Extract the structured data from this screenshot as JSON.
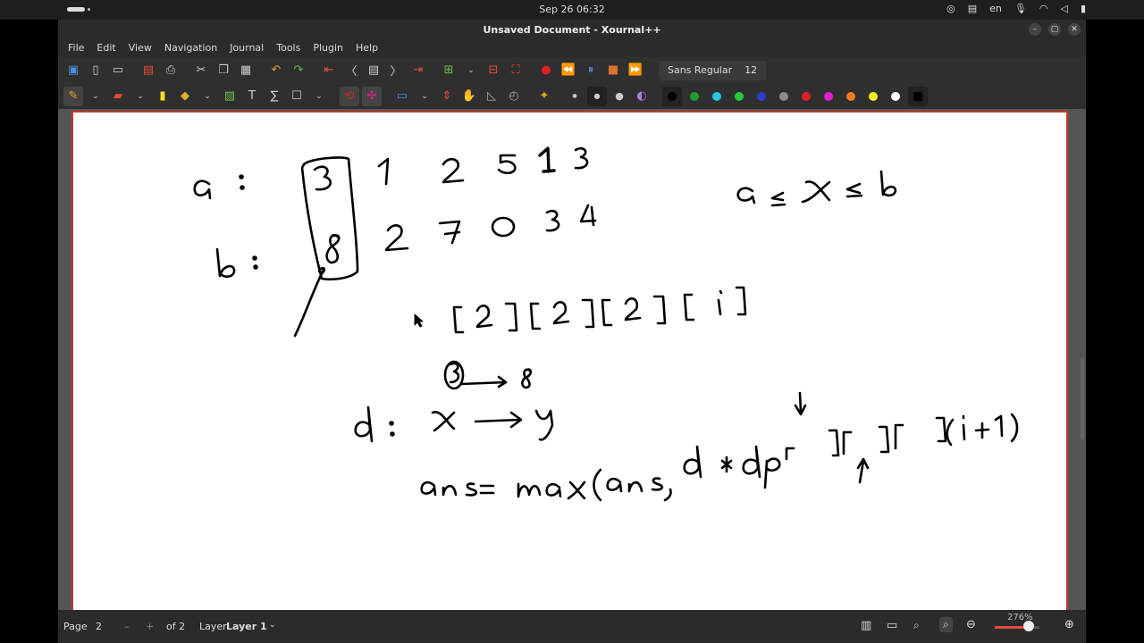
{
  "system": {
    "clock": "Sep 26  06:32",
    "lang": "en"
  },
  "window": {
    "title": "Unsaved Document - Xournal++"
  },
  "menu": [
    "File",
    "Edit",
    "View",
    "Navigation",
    "Journal",
    "Tools",
    "Plugin",
    "Help"
  ],
  "font": {
    "name": "Sans Regular",
    "size": "12"
  },
  "palette": [
    "#000000",
    "#1a9e2e",
    "#25c9e0",
    "#27c93f",
    "#2f3bd4",
    "#8a8a8a",
    "#e02020",
    "#e020c9",
    "#f07c1e",
    "#f5f020",
    "#ffffff",
    "#000000"
  ],
  "status": {
    "page_label": "Page",
    "page_value": "2",
    "of_label": "of 2",
    "layer_label": "Layer",
    "layer_value": "Layer 1",
    "zoom": "276%",
    "zoom_level": 0.75
  }
}
